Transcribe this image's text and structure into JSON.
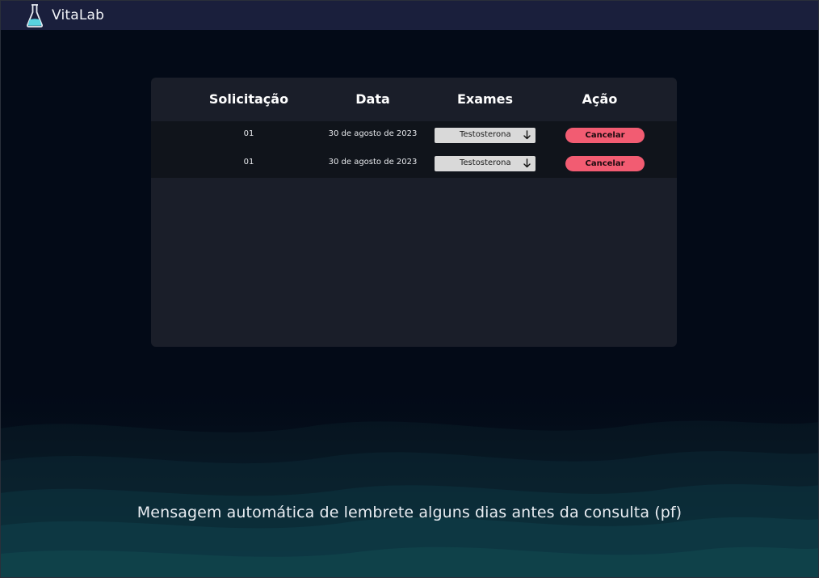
{
  "brand": {
    "name": "VitaLab",
    "icon": "flask-icon"
  },
  "table": {
    "headers": [
      "Solicitação",
      "Data",
      "Exames",
      "Ação"
    ],
    "rows": [
      {
        "id": "01",
        "date": "30 de agosto de 2023",
        "exam": "Testosterona",
        "action": "Cancelar"
      },
      {
        "id": "01",
        "date": "30 de agosto de 2023",
        "exam": "Testosterona",
        "action": "Cancelar"
      }
    ]
  },
  "message": "Mensagem automática de lembrete alguns dias antes da consulta (pf)",
  "colors": {
    "background": "#030a17",
    "navbar": "#1a1f3c",
    "card": "#1a1e29",
    "row_band": "#10141b",
    "cancel_button": "#f25c72",
    "select": "#d9d9d9",
    "flask_liquid": "#58d2e0"
  }
}
